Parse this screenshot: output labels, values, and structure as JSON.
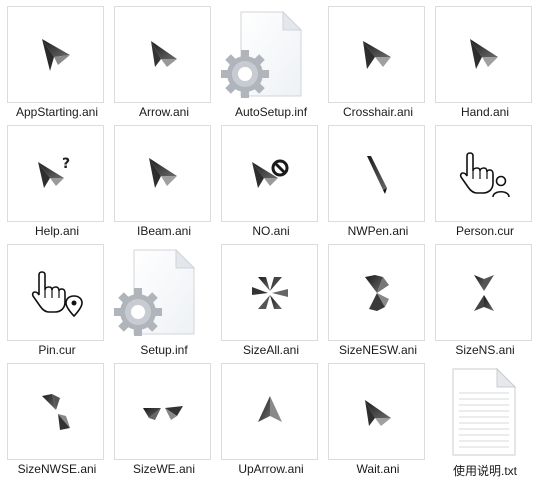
{
  "files": [
    {
      "name": "AppStarting.ani",
      "icon": "arrow-cursor-icon"
    },
    {
      "name": "Arrow.ani",
      "icon": "arrow-cursor-icon"
    },
    {
      "name": "AutoSetup.inf",
      "icon": "settings-file-icon"
    },
    {
      "name": "Crosshair.ani",
      "icon": "arrow-cursor-icon"
    },
    {
      "name": "Hand.ani",
      "icon": "arrow-cursor-icon"
    },
    {
      "name": "Help.ani",
      "icon": "help-cursor-icon"
    },
    {
      "name": "IBeam.ani",
      "icon": "arrow-cursor-icon"
    },
    {
      "name": "NO.ani",
      "icon": "unavailable-cursor-icon"
    },
    {
      "name": "NWPen.ani",
      "icon": "pen-cursor-icon"
    },
    {
      "name": "Person.cur",
      "icon": "hand-person-cursor-icon"
    },
    {
      "name": "Pin.cur",
      "icon": "hand-pin-cursor-icon"
    },
    {
      "name": "Setup.inf",
      "icon": "settings-file-icon"
    },
    {
      "name": "SizeAll.ani",
      "icon": "move-cursor-icon"
    },
    {
      "name": "SizeNESW.ani",
      "icon": "resize-diagonal-cursor-icon"
    },
    {
      "name": "SizeNS.ani",
      "icon": "resize-vertical-cursor-icon"
    },
    {
      "name": "SizeNWSE.ani",
      "icon": "resize-diagonal-cursor-icon"
    },
    {
      "name": "SizeWE.ani",
      "icon": "resize-horizontal-cursor-icon"
    },
    {
      "name": "UpArrow.ani",
      "icon": "up-arrow-cursor-icon"
    },
    {
      "name": "Wait.ani",
      "icon": "arrow-cursor-icon"
    },
    {
      "name": "使用说明.txt",
      "icon": "text-document-icon"
    }
  ]
}
